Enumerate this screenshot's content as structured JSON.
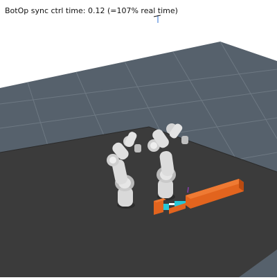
{
  "status": {
    "text": "BotOp sync ctrl time: 0.12 (=107% real time)"
  },
  "scene": {
    "colors": {
      "background": "#ffffff",
      "floor": "#56616c",
      "floor_grid": "#6e7983",
      "table": "#3b3b3b",
      "table_edge": "#2a2a2a",
      "robot_link": "#d9d9d9",
      "robot_shadow": "#9a9a9a",
      "box": "#e2641e",
      "box_dark": "#b94a10",
      "connector": "#27c6d6"
    },
    "objects": [
      "floor-grid",
      "table-surface",
      "robot-arm-left",
      "robot-arm-right",
      "orange-box-long",
      "orange-box-short",
      "cyan-connector"
    ]
  }
}
